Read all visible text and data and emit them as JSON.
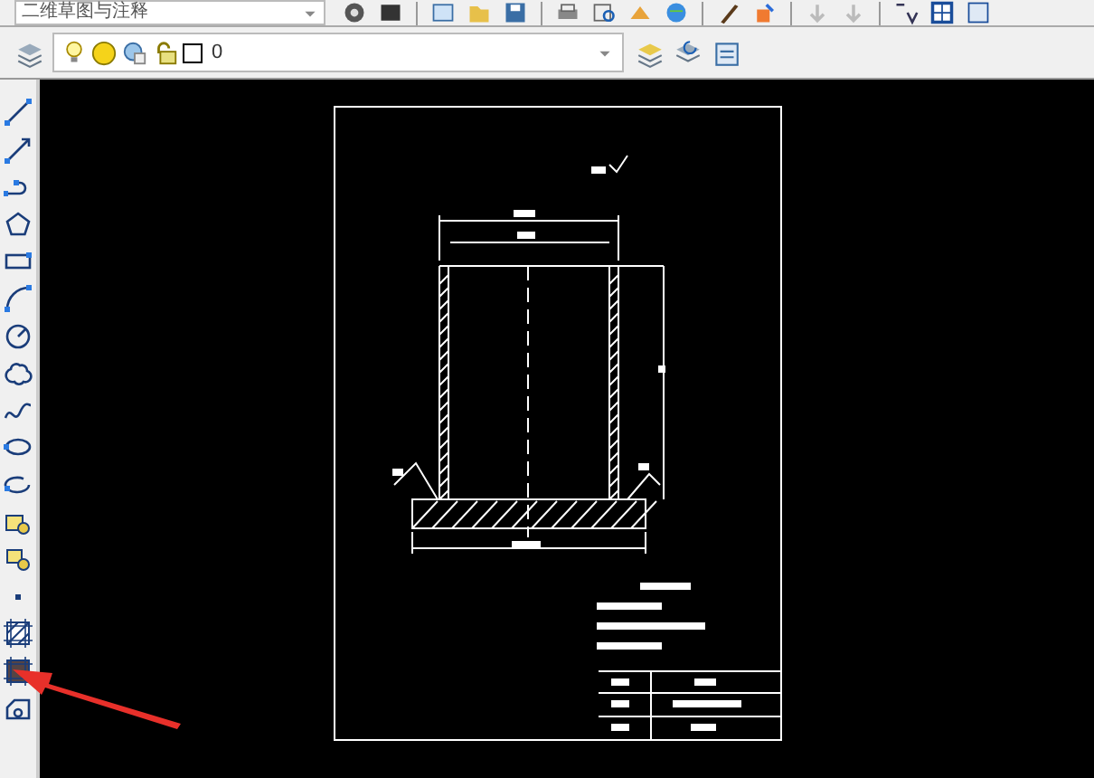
{
  "toolbar": {
    "workspace": "二维草图与注释"
  },
  "layer_bar": {
    "layer_name": "0"
  }
}
